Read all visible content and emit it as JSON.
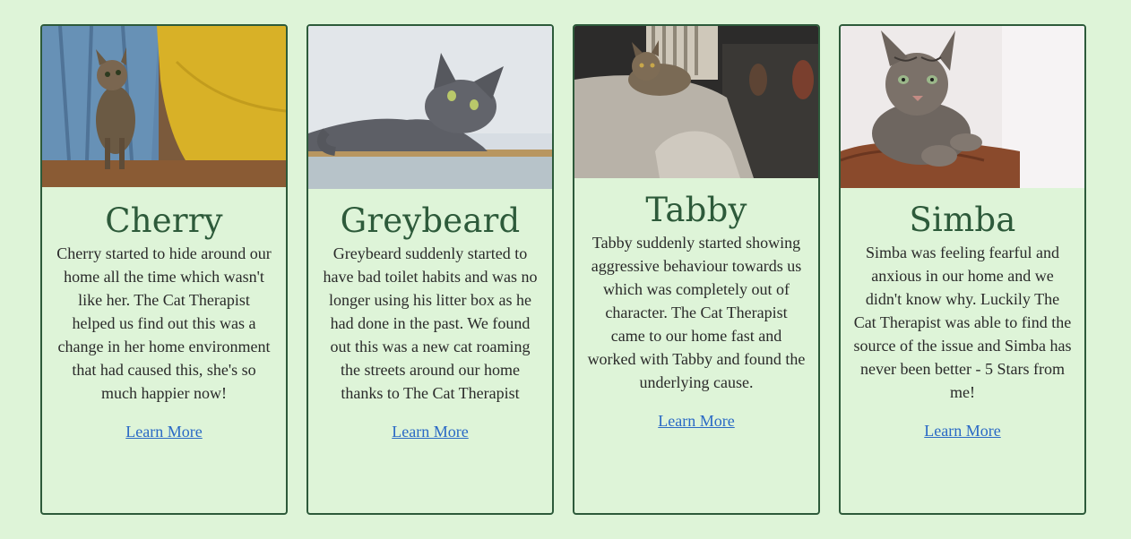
{
  "colors": {
    "page_background": "#def4d8",
    "card_border": "#2d5a3a",
    "title_color": "#2d5a3a",
    "link_color": "#2a69c5"
  },
  "cards": [
    {
      "name": "Cherry",
      "description": "Cherry started to hide around our home all the time which wasn't like her. The Cat Therapist helped us find out this was a change in her home environment that had caused this, she's so much happier now!",
      "link_label": "Learn More",
      "photo_icon": "tabby-kitten-photo"
    },
    {
      "name": "Greybeard",
      "description": "Greybeard suddenly started to have bad toilet habits and was no longer using his litter box as he had done in the past. We found out this was a new cat roaming the streets around our home thanks to The Cat Therapist",
      "link_label": "Learn More",
      "photo_icon": "grey-cat-photo"
    },
    {
      "name": "Tabby",
      "description": "Tabby suddenly started showing aggressive behaviour towards us which was completely out of character. The Cat Therapist came to our home fast and worked with Tabby and found the underlying cause.",
      "link_label": "Learn More",
      "photo_icon": "tabby-on-sofa-photo"
    },
    {
      "name": "Simba",
      "description": "Simba was feeling fearful and anxious in our home and we didn't know why. Luckily The Cat Therapist was able to find the source of the issue and Simba has never been better - 5 Stars from me!",
      "link_label": "Learn More",
      "photo_icon": "striped-cat-photo"
    }
  ]
}
